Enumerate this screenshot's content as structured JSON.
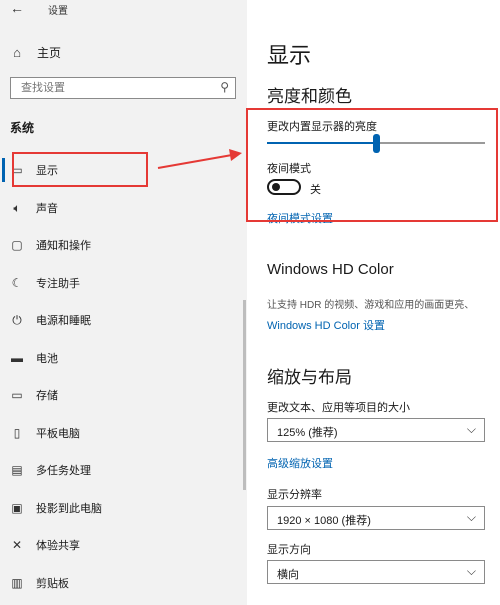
{
  "window": {
    "title": "设置"
  },
  "sidebar": {
    "home_label": "主页",
    "search_placeholder": "查找设置",
    "section": "系统",
    "items": [
      {
        "label": "显示",
        "icon": "monitor-icon"
      },
      {
        "label": "声音",
        "icon": "speaker-icon"
      },
      {
        "label": "通知和操作",
        "icon": "notification-icon"
      },
      {
        "label": "专注助手",
        "icon": "moon-icon"
      },
      {
        "label": "电源和睡眠",
        "icon": "power-icon"
      },
      {
        "label": "电池",
        "icon": "battery-icon"
      },
      {
        "label": "存储",
        "icon": "storage-icon"
      },
      {
        "label": "平板电脑",
        "icon": "tablet-icon"
      },
      {
        "label": "多任务处理",
        "icon": "multitask-icon"
      },
      {
        "label": "投影到此电脑",
        "icon": "project-icon"
      },
      {
        "label": "体验共享",
        "icon": "share-icon"
      },
      {
        "label": "剪贴板",
        "icon": "clipboard-icon"
      }
    ]
  },
  "main": {
    "title": "显示",
    "brightness_section": {
      "heading": "亮度和颜色",
      "slider_label": "更改内置显示器的亮度",
      "brightness_level": 0.5,
      "night_mode_label": "夜间模式",
      "night_mode_state": "关",
      "night_mode_link": "夜间模式设置"
    },
    "hdr_section": {
      "heading": "Windows HD Color",
      "description": "让支持 HDR 的视频、游戏和应用的画面更亮、",
      "link": "Windows HD Color 设置"
    },
    "scale_section": {
      "heading": "缩放与布局",
      "scale_label": "更改文本、应用等项目的大小",
      "scale_value": "125% (推荐)",
      "advanced_link": "高级缩放设置",
      "resolution_label": "显示分辨率",
      "resolution_value": "1920 × 1080 (推荐)",
      "orientation_label": "显示方向",
      "orientation_value": "横向"
    }
  },
  "colors": {
    "accent": "#0063b1",
    "annotation": "#e53935"
  }
}
